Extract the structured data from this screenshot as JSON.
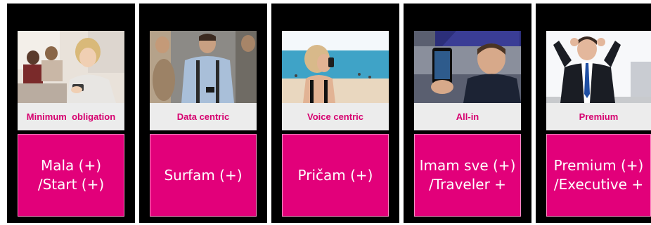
{
  "colors": {
    "magenta": "#e2007a",
    "label_text": "#d6006f",
    "label_bg": "#ececec",
    "frame": "#000000"
  },
  "plans": [
    {
      "photo_icon": "woman-smiling-at-phone-photo",
      "category": "Minimum  obligation",
      "name_line1": "Mala (+)",
      "name_line2": "/Start (+)"
    },
    {
      "photo_icon": "man-checking-phone-photo",
      "category": "Data centric",
      "name_line1": "Surfam (+)",
      "name_line2": ""
    },
    {
      "photo_icon": "woman-calling-at-beach-photo",
      "category": "Voice centric",
      "name_line1": "Pričam (+)",
      "name_line2": ""
    },
    {
      "photo_icon": "man-holding-smartphone-photo",
      "category": "All-in",
      "name_line1": "Imam sve (+)",
      "name_line2": "/Traveler +"
    },
    {
      "photo_icon": "relaxed-businessman-photo",
      "category": "Premium",
      "name_line1": "Premium (+)",
      "name_line2": "/Executive +"
    }
  ]
}
